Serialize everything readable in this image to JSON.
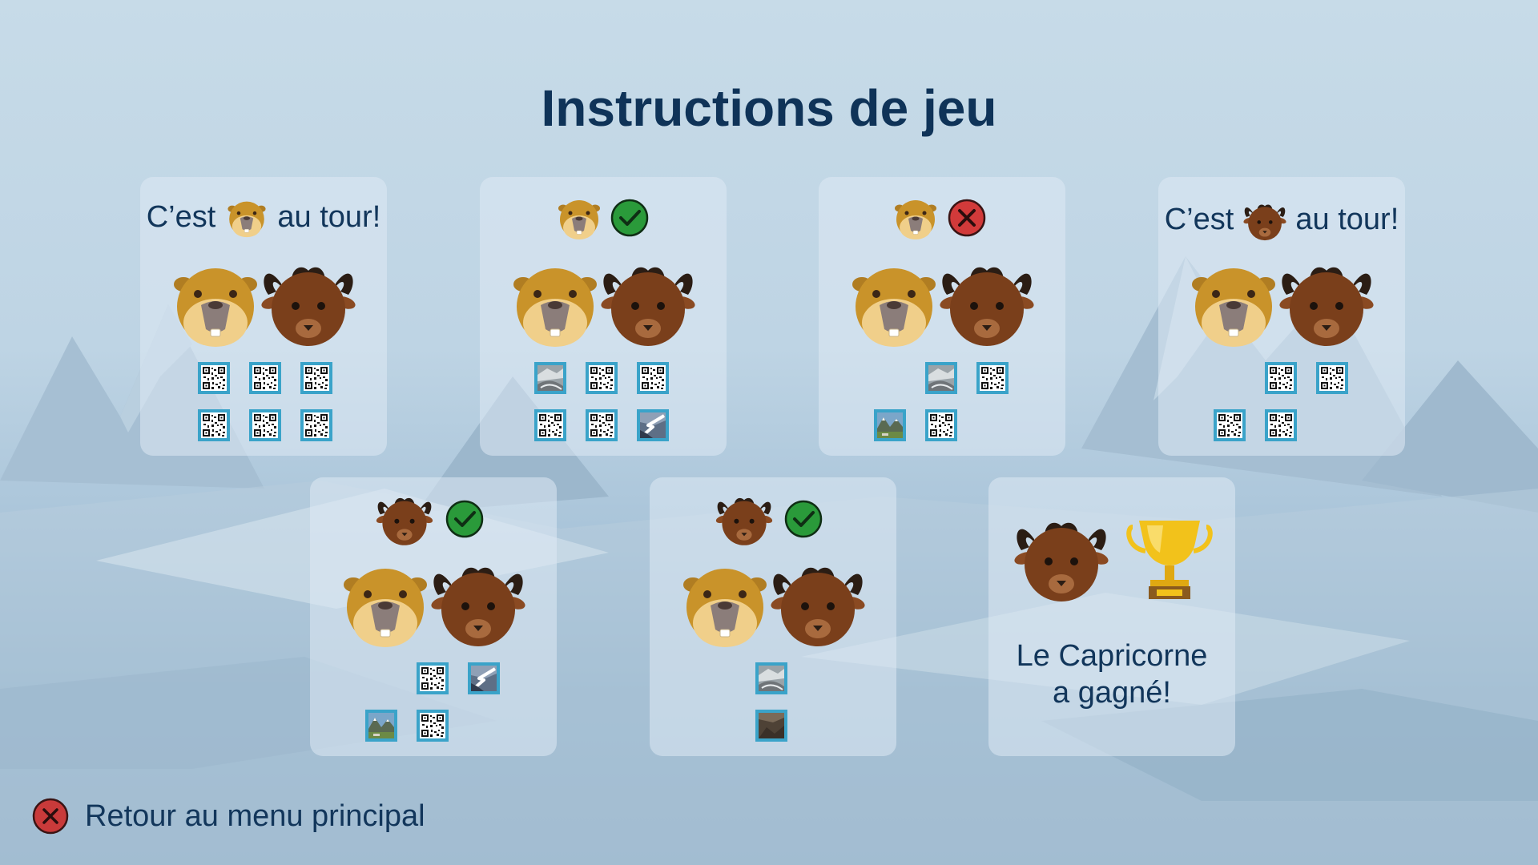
{
  "page": {
    "title": "Instructions de jeu",
    "back_label": "Retour au menu principal"
  },
  "players": {
    "marmot": {
      "name": "marmot",
      "fur": "#c9932a",
      "face": "#f0cf8a"
    },
    "ibex": {
      "name": "ibex",
      "fur": "#7a3f1b",
      "horns": "#2b1d14"
    }
  },
  "colors": {
    "title": "#0f3358",
    "check": "#2a9a3a",
    "cross": "#d23a3a",
    "tile_border": "#3aa3c9",
    "trophy": "#f2c21b"
  },
  "cards": [
    {
      "turn_prefix": "C’est",
      "turn_suffix": "au tour!",
      "active": "marmot",
      "indicator": null,
      "row1": [
        "qr",
        "qr",
        "qr"
      ],
      "row2": [
        "qr",
        "qr",
        "qr"
      ]
    },
    {
      "active": "marmot",
      "indicator": "check",
      "row1": [
        "photo-glacier",
        "qr",
        "qr"
      ],
      "row2": [
        "qr",
        "qr",
        "photo-river"
      ]
    },
    {
      "active": "marmot",
      "indicator": "cross",
      "row1": [
        "empty",
        "photo-glacier",
        "qr"
      ],
      "row2": [
        "photo-valley",
        "qr",
        "empty"
      ]
    },
    {
      "turn_prefix": "C’est",
      "turn_suffix": "au tour!",
      "active": "ibex",
      "indicator": null,
      "row1": [
        "empty",
        "qr",
        "qr"
      ],
      "row2": [
        "qr",
        "qr",
        "empty"
      ]
    },
    {
      "active": "ibex",
      "indicator": "check",
      "row1": [
        "empty",
        "qr",
        "photo-river"
      ],
      "row2": [
        "photo-valley",
        "qr",
        "empty"
      ]
    },
    {
      "active": "ibex",
      "indicator": "check",
      "row1": [
        "empty",
        "photo-glacier",
        "empty"
      ],
      "row2": [
        "empty",
        "photo-rock",
        "empty"
      ]
    },
    {
      "winner": "ibex",
      "win_line1": "Le Capricorne",
      "win_line2": "a gagné!",
      "trophy": "trophy-icon"
    }
  ]
}
